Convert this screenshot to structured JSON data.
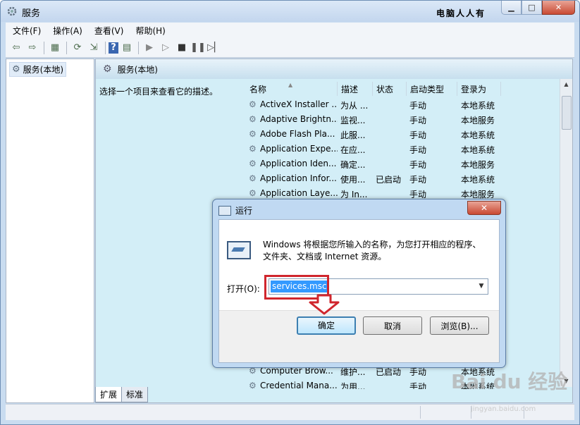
{
  "window": {
    "title": "服务",
    "watermark_top": "电脑人人有",
    "buttons": {
      "minimize": "▁",
      "maximize": "□",
      "close": "✕"
    }
  },
  "menu": [
    "文件(F)",
    "操作(A)",
    "查看(V)",
    "帮助(H)"
  ],
  "tree": {
    "root": "服务(本地)"
  },
  "main": {
    "header": "服务(本地)",
    "description_prompt": "选择一个项目来查看它的描述。",
    "columns": [
      "名称",
      "描述",
      "状态",
      "启动类型",
      "登录为"
    ],
    "rows": [
      [
        "ActiveX Installer ...",
        "为从 ...",
        "",
        "手动",
        "本地系统"
      ],
      [
        "Adaptive Brightn...",
        "监视...",
        "",
        "手动",
        "本地服务"
      ],
      [
        "Adobe Flash Pla...",
        "此服...",
        "",
        "手动",
        "本地系统"
      ],
      [
        "Application Expe...",
        "在应...",
        "",
        "手动",
        "本地系统"
      ],
      [
        "Application Iden...",
        "确定...",
        "",
        "手动",
        "本地服务"
      ],
      [
        "Application Infor...",
        "使用...",
        "已启动",
        "手动",
        "本地系统"
      ],
      [
        "Application Laye...",
        "为 In...",
        "",
        "手动",
        "本地服务"
      ]
    ],
    "bottom_rows": [
      [
        "Computer Brow...",
        "维护...",
        "已启动",
        "手动",
        "本地系统"
      ],
      [
        "Credential Mana...",
        "为用...",
        "",
        "手动",
        "本地系统"
      ]
    ]
  },
  "tabs": [
    "扩展",
    "标准"
  ],
  "dialog": {
    "title": "运行",
    "close": "✕",
    "message": "Windows 将根据您所输入的名称，为您打开相应的程序、文件夹、文档或 Internet 资源。",
    "open_label": "打开(O):",
    "input_value": "services.msc",
    "ok": "确定",
    "cancel": "取消",
    "browse": "浏览(B)..."
  },
  "watermark": {
    "brand": "Bai du 经验",
    "url": "jingyan.baidu.com"
  },
  "colors": {
    "highlight": "#d0262d",
    "selection": "#3399ff"
  }
}
